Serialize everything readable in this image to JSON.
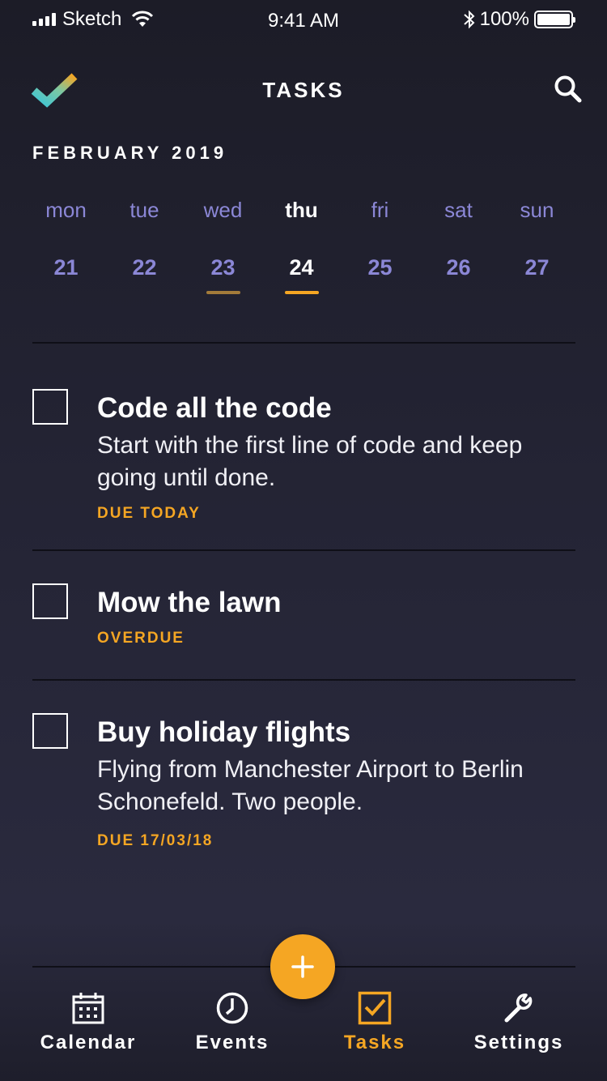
{
  "status_bar": {
    "carrier": "Sketch",
    "time": "9:41 AM",
    "battery": "100%"
  },
  "nav": {
    "title": "TASKS",
    "logo_icon": "checkmark-logo-icon",
    "search_icon": "search-icon"
  },
  "calendar": {
    "month": "FEBRUARY 2019",
    "days": [
      {
        "name": "mon",
        "num": "21"
      },
      {
        "name": "tue",
        "num": "22"
      },
      {
        "name": "wed",
        "num": "23"
      },
      {
        "name": "thu",
        "num": "24"
      },
      {
        "name": "fri",
        "num": "25"
      },
      {
        "name": "sat",
        "num": "26"
      },
      {
        "name": "sun",
        "num": "27"
      }
    ],
    "selected_day": "thu"
  },
  "tasks": [
    {
      "title": "Code all the code",
      "description": "Start with the first line of code and keep going until done.",
      "due": "DUE TODAY",
      "checked": false
    },
    {
      "title": "Mow the lawn",
      "description": "",
      "due": "OVERDUE",
      "checked": false
    },
    {
      "title": "Buy holiday flights",
      "description": "Flying from Manchester Airport to Berlin Schonefeld. Two people.",
      "due": "DUE 17/03/18",
      "checked": false
    }
  ],
  "fab": {
    "icon": "plus-icon"
  },
  "tabbar": {
    "items": [
      {
        "label": "Calendar",
        "icon": "calendar-icon"
      },
      {
        "label": "Events",
        "icon": "clock-icon"
      },
      {
        "label": "Tasks",
        "icon": "checkbox-icon"
      },
      {
        "label": "Settings",
        "icon": "wrench-icon"
      }
    ],
    "active": "Tasks"
  },
  "colors": {
    "accent": "#f5a623",
    "day_text": "#8b87d6",
    "background": "#232333"
  }
}
